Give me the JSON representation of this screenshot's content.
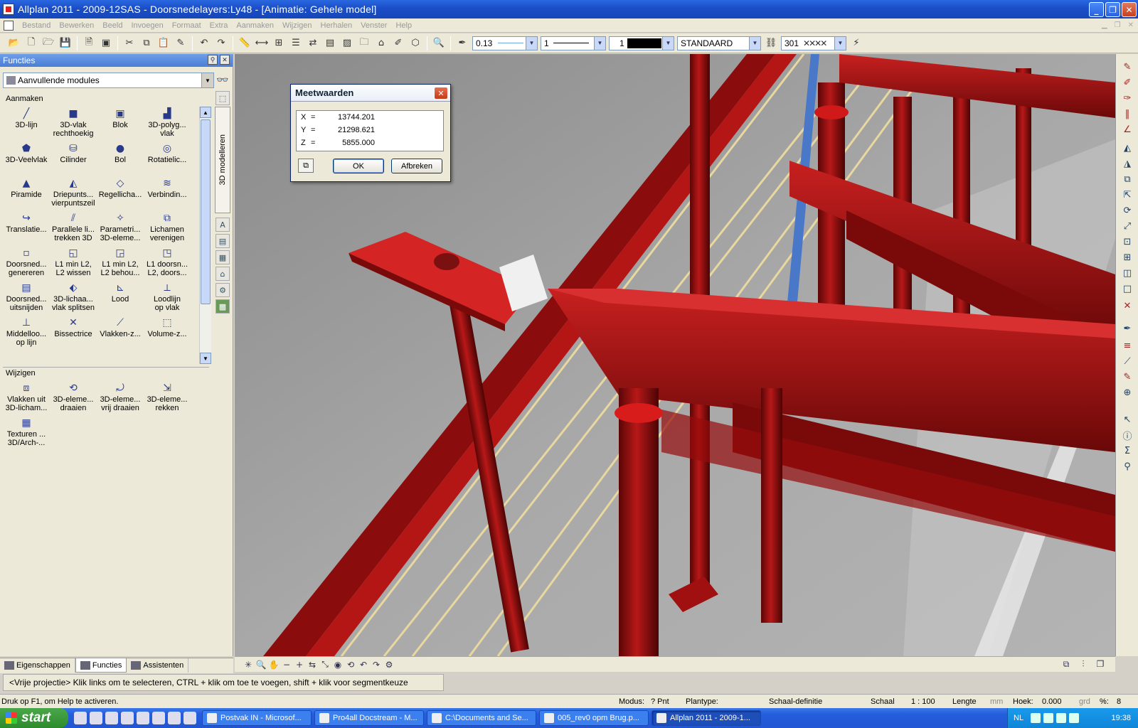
{
  "window": {
    "title": "Allplan 2011 - 2009-12SAS - Doorsnedelayers:Ly48 - [Animatie: Gehele model]"
  },
  "menu": [
    "Bestand",
    "Bewerken",
    "Beeld",
    "Invoegen",
    "Formaat",
    "Extra",
    "Aanmaken",
    "Wijzigen",
    "Herhalen",
    "Venster",
    "Help"
  ],
  "toolbar": {
    "pen_thickness": "0.13",
    "line_type": "1",
    "color": "1",
    "layer_style": "STANDAARD",
    "hatch": "301"
  },
  "functions_panel": {
    "header": "Functies",
    "module_select": "Aanvullende modules",
    "side_tab": "3D modelleren",
    "section_create": "Aanmaken",
    "create_tools": [
      {
        "label": "3D-lijn",
        "icon": "3d-line-icon",
        "glyph": "╱"
      },
      {
        "label": "3D-vlak\nrechthoekig",
        "icon": "3d-rect-surface-icon",
        "glyph": "■"
      },
      {
        "label": "Blok",
        "icon": "block-icon",
        "glyph": "▣"
      },
      {
        "label": "3D-polyg...\nvlak",
        "icon": "3d-polygon-surface-icon",
        "glyph": "▟"
      },
      {
        "label": "3D-Veelvlak",
        "icon": "polyhedron-icon",
        "glyph": "⬟"
      },
      {
        "label": "Cilinder",
        "icon": "cylinder-icon",
        "glyph": "⛁"
      },
      {
        "label": "Bol",
        "icon": "sphere-icon",
        "glyph": "●"
      },
      {
        "label": "Rotatielic...",
        "icon": "rotation-body-icon",
        "glyph": "◎"
      },
      {
        "label": "Piramide",
        "icon": "pyramid-icon",
        "glyph": "▲"
      },
      {
        "label": "Driepunts...\nvierpuntszeil",
        "icon": "sail-icon",
        "glyph": "◭"
      },
      {
        "label": "Regellicha...",
        "icon": "ruled-body-icon",
        "glyph": "◇"
      },
      {
        "label": "Verbindin...",
        "icon": "connection-icon",
        "glyph": "≋"
      },
      {
        "label": "Translatie...",
        "icon": "translation-icon",
        "glyph": "↪"
      },
      {
        "label": "Parallele li...\ntrekken 3D",
        "icon": "parallel-lines-icon",
        "glyph": "⫽"
      },
      {
        "label": "Parametri...\n3D-eleme...",
        "icon": "parametric-icon",
        "glyph": "✧"
      },
      {
        "label": "Lichamen\nverenigen",
        "icon": "union-icon",
        "glyph": "⧉"
      },
      {
        "label": "Doorsned...\ngenereren",
        "icon": "section-generate-icon",
        "glyph": "▫"
      },
      {
        "label": "L1 min L2,\nL2 wissen",
        "icon": "subtract-delete-icon",
        "glyph": "◱"
      },
      {
        "label": "L1 min L2,\nL2 behou...",
        "icon": "subtract-keep-icon",
        "glyph": "◲"
      },
      {
        "label": "L1 doorsn...\nL2, doors...",
        "icon": "intersect-icon",
        "glyph": "◳"
      },
      {
        "label": "Doorsned...\nuitsnijden",
        "icon": "section-cut-icon",
        "glyph": "▤"
      },
      {
        "label": "3D-lichaa...\nvlak splitsen",
        "icon": "split-body-icon",
        "glyph": "⬖"
      },
      {
        "label": "Lood",
        "icon": "perpendicular-icon",
        "glyph": "⊾"
      },
      {
        "label": "Loodlijn\nop vlak",
        "icon": "normal-line-icon",
        "glyph": "⟂"
      },
      {
        "label": "Middelloo...\nop lijn",
        "icon": "mid-perpendicular-icon",
        "glyph": "⊥"
      },
      {
        "label": "Bissectrice",
        "icon": "bisector-icon",
        "glyph": "✕"
      },
      {
        "label": "Vlakken-z...",
        "icon": "surface-intersect-icon",
        "glyph": "⟋"
      },
      {
        "label": "Volume-z...",
        "icon": "volume-intersect-icon",
        "glyph": "⬚"
      }
    ],
    "section_modify": "Wijzigen",
    "modify_tools": [
      {
        "label": "Vlakken uit\n3D-licham...",
        "icon": "surfaces-from-body-icon",
        "glyph": "⧈"
      },
      {
        "label": "3D-eleme...\ndraaien",
        "icon": "rotate-3d-icon",
        "glyph": "⟲"
      },
      {
        "label": "3D-eleme...\nvrij draaien",
        "icon": "free-rotate-icon",
        "glyph": "⤾"
      },
      {
        "label": "3D-eleme...\nrekken",
        "icon": "stretch-icon",
        "glyph": "⇲"
      },
      {
        "label": "Texturen ...\n3D/Arch-...",
        "icon": "texture-icon",
        "glyph": "▦"
      }
    ]
  },
  "panel_tabs": [
    "Eigenschappen",
    "Functies",
    "Assistenten"
  ],
  "dialog": {
    "title": "Meetwaarden",
    "x_label": "X",
    "x_value": "13744.201",
    "y_label": "Y",
    "y_value": "21298.621",
    "z_label": "Z",
    "z_value": "5855.000",
    "ok": "OK",
    "cancel": "Afbreken"
  },
  "command_line": "<Vrije projectie> Klik links om te selecteren, CTRL + klik om toe te voegen, shift + klik voor segmentkeuze",
  "status": {
    "help": "Druk op F1, om Help te activeren.",
    "modus_label": "Modus:",
    "modus_value": "? Pnt",
    "plantype_label": "Plantype:",
    "schaaldef": "Schaal-definitie",
    "schaal_label": "Schaal",
    "schaal_value": "1 : 100",
    "lengte_label": "Lengte",
    "lengte_unit": "mm",
    "hoek_label": "Hoek:",
    "hoek_value": "0.000",
    "hoek_unit": "grd",
    "percent_label": "%:",
    "percent_value": "8"
  },
  "taskbar": {
    "start": "start",
    "tasks": [
      {
        "label": "Postvak IN - Microsof...",
        "active": false
      },
      {
        "label": "Pro4all Docstream - M...",
        "active": false
      },
      {
        "label": "C:\\Documents and Se...",
        "active": false
      },
      {
        "label": "005_rev0 opm Brug.p...",
        "active": false
      },
      {
        "label": "Allplan 2011 - 2009-1...",
        "active": true
      }
    ],
    "lang": "NL",
    "clock": "19:38"
  }
}
